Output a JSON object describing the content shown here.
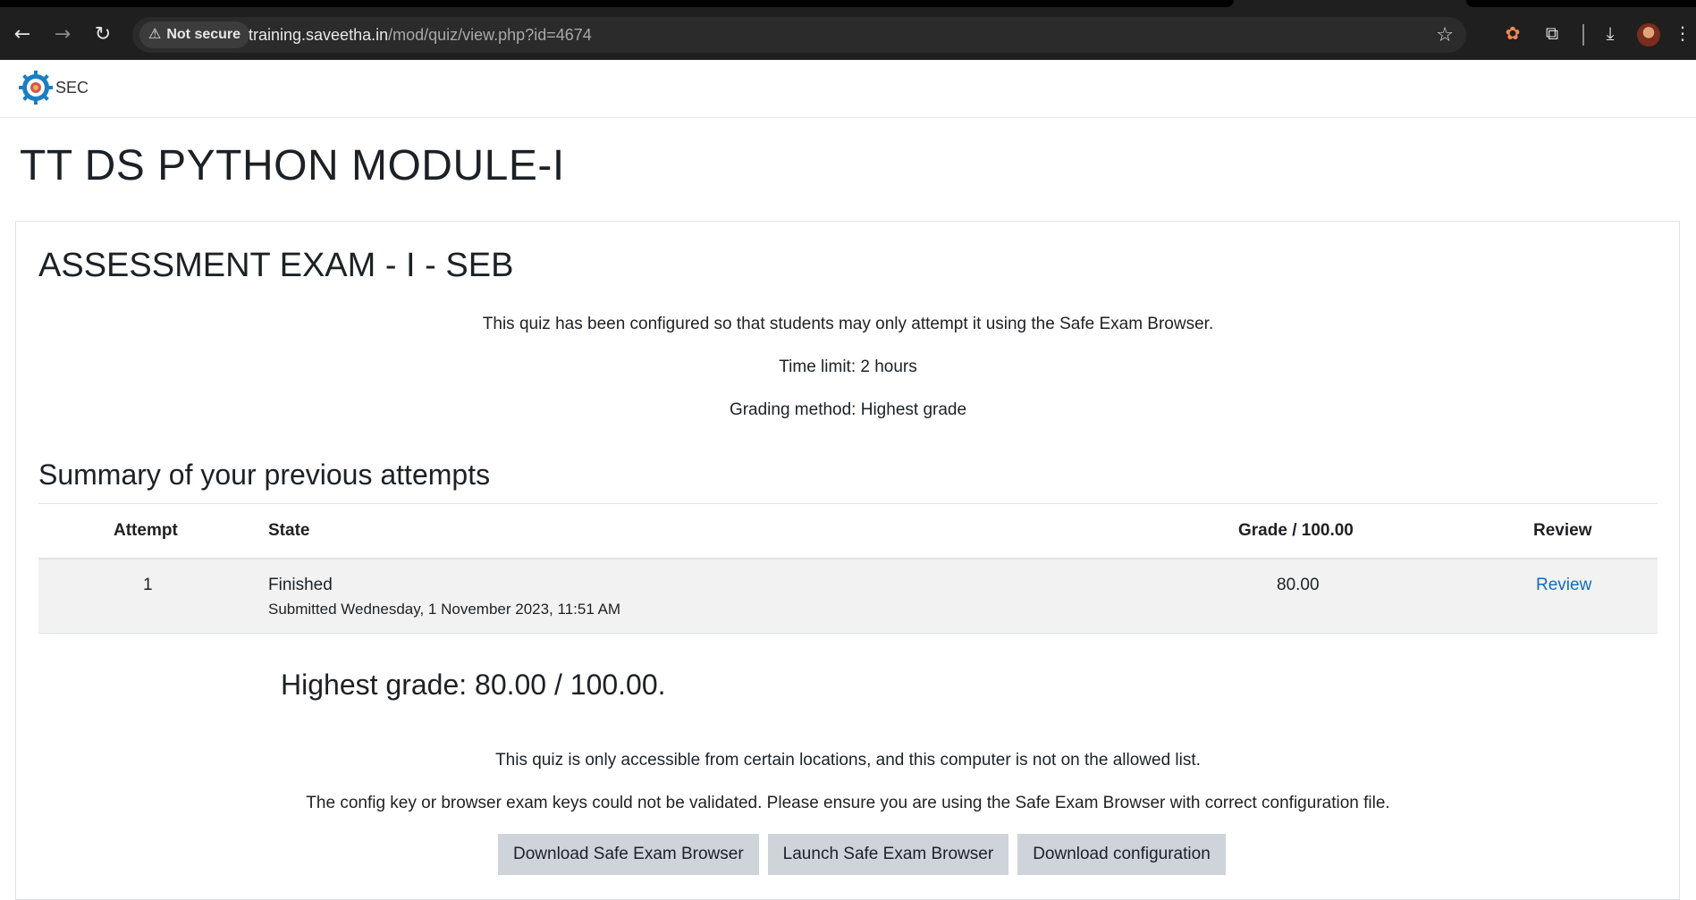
{
  "browser": {
    "security_label": "Not secure",
    "url_host": "training.saveetha.in",
    "url_path": "/mod/quiz/view.php?id=4674"
  },
  "site": {
    "logo_text": "SEC"
  },
  "page": {
    "title": "TT DS PYTHON MODULE-I",
    "quiz_name": "ASSESSMENT EXAM - I - SEB",
    "info": [
      "This quiz has been configured so that students may only attempt it using the Safe Exam Browser.",
      "Time limit: 2 hours",
      "Grading method: Highest grade"
    ],
    "summary_heading": "Summary of your previous attempts",
    "table": {
      "headers": [
        "Attempt",
        "State",
        "Grade / 100.00",
        "Review"
      ],
      "rows": [
        {
          "attempt": "1",
          "state": "Finished",
          "submitted": "Submitted Wednesday, 1 November 2023, 11:51 AM",
          "grade": "80.00",
          "review": "Review"
        }
      ]
    },
    "highest_grade": "Highest grade: 80.00 / 100.00.",
    "messages": [
      "This quiz is only accessible from certain locations, and this computer is not on the allowed list.",
      "The config key or browser exam keys could not be validated. Please ensure you are using the Safe Exam Browser with correct configuration file."
    ],
    "buttons": {
      "download_seb": "Download Safe Exam Browser",
      "launch_seb": "Launch Safe Exam Browser",
      "download_config": "Download configuration"
    }
  }
}
